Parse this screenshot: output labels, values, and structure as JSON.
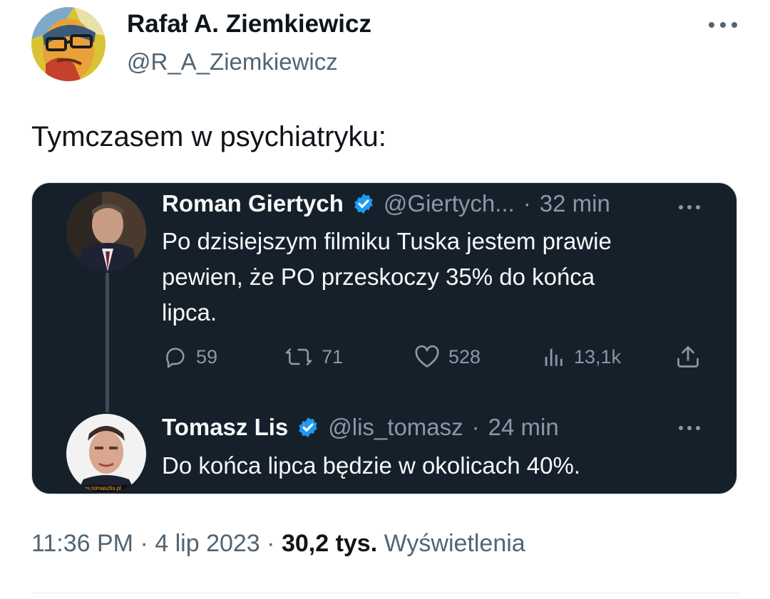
{
  "author": {
    "name": "Rafał A. Ziemkiewicz",
    "handle": "@R_A_Ziemkiewicz"
  },
  "tweet": {
    "text": "Tymczasem w psychiatryku:"
  },
  "quoted_thread": [
    {
      "name": "Roman Giertych",
      "handle": "@Giertych...",
      "separator": "·",
      "time": "32 min",
      "lines": [
        "Po dzisiejszym filmiku Tuska jestem prawie",
        "pewien, że PO przeskoczy 35% do końca",
        "lipca."
      ],
      "actions": {
        "replies": "59",
        "retweets": "71",
        "likes": "528",
        "views": "13,1k"
      }
    },
    {
      "name": "Tomasz Lis",
      "handle": "@lis_tomasz",
      "separator": "·",
      "time": "24 min",
      "lines": [
        "Do końca lipca będzie w okolicach 40%."
      ],
      "avatar_watermark": "www.tomaszlis.pl"
    }
  ],
  "footer": {
    "time": "11:36 PM",
    "separator1": "·",
    "date": "4 lip 2023",
    "separator2": "·",
    "views_count": "30,2 tys.",
    "views_label": "Wyświetlenia"
  },
  "colors": {
    "card_bg": "#15202b",
    "verified": "#1d9bf0",
    "secondary_text": "#536471"
  },
  "icons": [
    "more-icon",
    "verified-badge-icon",
    "reply-icon",
    "retweet-icon",
    "like-icon",
    "views-icon",
    "share-icon"
  ]
}
